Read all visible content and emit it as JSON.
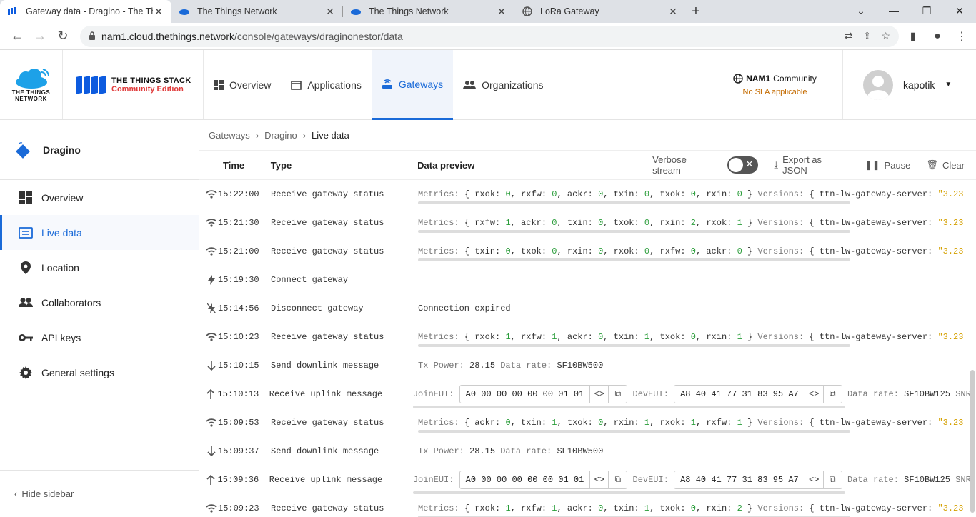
{
  "browser": {
    "tabs": [
      {
        "title": "Gateway data - Dragino - The Things Stack",
        "active": true
      },
      {
        "title": "The Things Network",
        "active": false
      },
      {
        "title": "The Things Network",
        "active": false
      },
      {
        "title": "LoRa Gateway",
        "active": false
      }
    ],
    "url_host": "nam1.cloud.thethings.network",
    "url_path": "/console/gateways/draginonestor/data"
  },
  "header": {
    "ttn_logo_line1": "THE THINGS",
    "ttn_logo_line2": "NETWORK",
    "tts_line1": "THE THINGS STACK",
    "tts_line2": "Community Edition",
    "nav": [
      {
        "label": "Overview",
        "active": false
      },
      {
        "label": "Applications",
        "active": false
      },
      {
        "label": "Gateways",
        "active": true
      },
      {
        "label": "Organizations",
        "active": false
      }
    ],
    "cluster_name": "NAM1",
    "cluster_suffix": "Community",
    "sla": "No SLA applicable",
    "username": "kapotik"
  },
  "sidebar": {
    "gateway_name": "Dragino",
    "items": [
      {
        "label": "Overview",
        "icon": "dashboard-icon",
        "active": false
      },
      {
        "label": "Live data",
        "icon": "live-data-icon",
        "active": true
      },
      {
        "label": "Location",
        "icon": "location-pin-icon",
        "active": false
      },
      {
        "label": "Collaborators",
        "icon": "people-icon",
        "active": false
      },
      {
        "label": "API keys",
        "icon": "key-icon",
        "active": false
      },
      {
        "label": "General settings",
        "icon": "gear-icon",
        "active": false
      }
    ],
    "hide_label": "Hide sidebar"
  },
  "breadcrumb": [
    "Gateways",
    "Dragino",
    "Live data"
  ],
  "table": {
    "headers": {
      "time": "Time",
      "type": "Type",
      "data": "Data preview"
    },
    "verbose_label": "Verbose stream",
    "export_label": "Export as JSON",
    "pause_label": "Pause",
    "clear_label": "Clear",
    "rows": [
      {
        "icon": "status",
        "time": "15:22:00",
        "type": "Receive gateway status",
        "kind": "metrics",
        "metrics": [
          [
            "rxok",
            "0"
          ],
          [
            "rxfw",
            "0"
          ],
          [
            "ackr",
            "0"
          ],
          [
            "txin",
            "0"
          ],
          [
            "txok",
            "0"
          ],
          [
            "rxin",
            "0"
          ]
        ]
      },
      {
        "icon": "status",
        "time": "15:21:30",
        "type": "Receive gateway status",
        "kind": "metrics",
        "metrics": [
          [
            "rxfw",
            "1"
          ],
          [
            "ackr",
            "0"
          ],
          [
            "txin",
            "0"
          ],
          [
            "txok",
            "0"
          ],
          [
            "rxin",
            "2"
          ],
          [
            "rxok",
            "1"
          ]
        ]
      },
      {
        "icon": "status",
        "time": "15:21:00",
        "type": "Receive gateway status",
        "kind": "metrics",
        "metrics": [
          [
            "txin",
            "0"
          ],
          [
            "txok",
            "0"
          ],
          [
            "rxin",
            "0"
          ],
          [
            "rxok",
            "0"
          ],
          [
            "rxfw",
            "0"
          ],
          [
            "ackr",
            "0"
          ]
        ]
      },
      {
        "icon": "connect",
        "time": "15:19:30",
        "type": "Connect gateway",
        "kind": "empty"
      },
      {
        "icon": "disconnect",
        "time": "15:14:56",
        "type": "Disconnect gateway",
        "kind": "text",
        "text": "Connection expired"
      },
      {
        "icon": "status",
        "time": "15:10:23",
        "type": "Receive gateway status",
        "kind": "metrics",
        "metrics": [
          [
            "rxok",
            "1"
          ],
          [
            "rxfw",
            "1"
          ],
          [
            "ackr",
            "0"
          ],
          [
            "txin",
            "1"
          ],
          [
            "txok",
            "0"
          ],
          [
            "rxin",
            "1"
          ]
        ]
      },
      {
        "icon": "down",
        "time": "15:10:15",
        "type": "Send downlink message",
        "kind": "downlink",
        "tx_power": "28.15",
        "data_rate": "SF10BW500"
      },
      {
        "icon": "up",
        "time": "15:10:13",
        "type": "Receive uplink message",
        "kind": "uplink",
        "join_eui": "A0 00 00 00 00 00 01 01",
        "dev_eui": "A8 40 41 77 31 83 95 A7",
        "data_rate": "SF10BW125"
      },
      {
        "icon": "status",
        "time": "15:09:53",
        "type": "Receive gateway status",
        "kind": "metrics",
        "metrics": [
          [
            "ackr",
            "0"
          ],
          [
            "txin",
            "1"
          ],
          [
            "txok",
            "0"
          ],
          [
            "rxin",
            "1"
          ],
          [
            "rxok",
            "1"
          ],
          [
            "rxfw",
            "1"
          ]
        ]
      },
      {
        "icon": "down",
        "time": "15:09:37",
        "type": "Send downlink message",
        "kind": "downlink",
        "tx_power": "28.15",
        "data_rate": "SF10BW500"
      },
      {
        "icon": "up",
        "time": "15:09:36",
        "type": "Receive uplink message",
        "kind": "uplink",
        "join_eui": "A0 00 00 00 00 00 01 01",
        "dev_eui": "A8 40 41 77 31 83 95 A7",
        "data_rate": "SF10BW125"
      },
      {
        "icon": "status",
        "time": "15:09:23",
        "type": "Receive gateway status",
        "kind": "metrics",
        "metrics": [
          [
            "rxok",
            "1"
          ],
          [
            "rxfw",
            "1"
          ],
          [
            "ackr",
            "0"
          ],
          [
            "txin",
            "1"
          ],
          [
            "txok",
            "0"
          ],
          [
            "rxin",
            "2"
          ]
        ]
      }
    ],
    "labels": {
      "metrics": "Metrics:",
      "versions": "Versions:",
      "version_key": "ttn-lw-gateway-server:",
      "version_val": "\"3.23",
      "tx_power": "Tx Power:",
      "data_rate": "Data rate:",
      "join_eui": "JoinEUI:",
      "dev_eui": "DevEUI:",
      "snr": "SNR:"
    }
  },
  "colors": {
    "accent": "#1a6ad8",
    "brand_red": "#e03b3b",
    "sla": "#c46b00"
  }
}
